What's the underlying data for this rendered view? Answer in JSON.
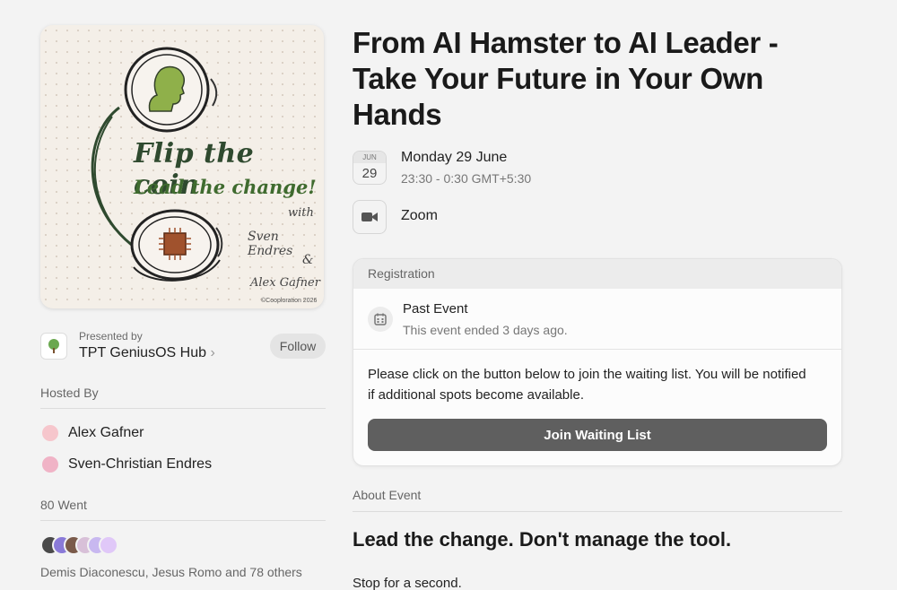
{
  "event": {
    "title": "From AI Hamster to AI Leader - Take Your Future in Your Own Hands",
    "date_month": "JUN",
    "date_day": "29",
    "date_main": "Monday 29 June",
    "date_time": "23:30 - 0:30 GMT+5:30",
    "location": "Zoom"
  },
  "cover": {
    "title": "Flip the coin",
    "subtitle": "Lead the change!",
    "with": "with",
    "name1": "Sven Endres",
    "amp": "&",
    "name2": "Alex Gafner",
    "copyright": "©Cooploration 2026"
  },
  "presenter": {
    "label": "Presented by",
    "name": "TPT GeniusOS Hub",
    "chevron": "›",
    "follow": "Follow",
    "logo_icon": "tree-icon"
  },
  "hosts": {
    "label": "Hosted By",
    "items": [
      {
        "name": "Alex Gafner",
        "avatar_color": "#f6c6cc"
      },
      {
        "name": "Sven-Christian Endres",
        "avatar_color": "#f0b3c6"
      }
    ]
  },
  "attendees": {
    "label": "80 Went",
    "summary": "Demis Diaconescu, Jesus Romo and 78 others",
    "avatar_colors": [
      "#4a4a4a",
      "#8a7ad8",
      "#7a5a4a",
      "#d8c0d8",
      "#c8b8f0",
      "#e0c8f8"
    ]
  },
  "registration": {
    "header": "Registration",
    "status_title": "Past Event",
    "status_sub": "This event ended 3 days ago.",
    "message": "Please click on the button below to join the waiting list. You will be notified if additional spots become available.",
    "button": "Join Waiting List"
  },
  "about": {
    "label": "About Event",
    "heading": "Lead the change. Don't manage the tool.",
    "body": "Stop for a second."
  }
}
